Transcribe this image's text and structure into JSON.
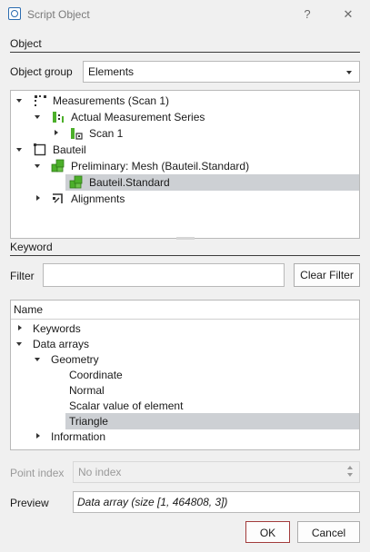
{
  "window": {
    "title": "Script Object",
    "help_glyph": "?",
    "close_glyph": "✕"
  },
  "object": {
    "section_label": "Object",
    "group_label": "Object group",
    "group_value": "Elements",
    "tree": [
      {
        "label": "Measurements (Scan 1)"
      },
      {
        "label": "Actual Measurement Series"
      },
      {
        "label": "Scan 1"
      },
      {
        "label": "Bauteil"
      },
      {
        "label": "Preliminary: Mesh (Bauteil.Standard)"
      },
      {
        "label": "Bauteil.Standard"
      },
      {
        "label": "Alignments"
      }
    ]
  },
  "keyword": {
    "section_label": "Keyword",
    "filter_label": "Filter",
    "filter_value": "",
    "clear_button": "Clear Filter",
    "column_header": "Name",
    "tree": [
      {
        "label": "Keywords"
      },
      {
        "label": "Data arrays"
      },
      {
        "label": "Geometry"
      },
      {
        "label": "Coordinate"
      },
      {
        "label": "Normal"
      },
      {
        "label": "Scalar value of element"
      },
      {
        "label": "Triangle"
      },
      {
        "label": "Information"
      }
    ]
  },
  "point_index": {
    "label": "Point index",
    "value": "No index"
  },
  "preview": {
    "label": "Preview",
    "value": "Data array (size [1, 464808, 3])"
  },
  "buttons": {
    "ok": "OK",
    "cancel": "Cancel"
  },
  "colors": {
    "selection": "#cdd0d4",
    "icon_green": "#4caf2a",
    "ok_border": "#a23b3b"
  }
}
